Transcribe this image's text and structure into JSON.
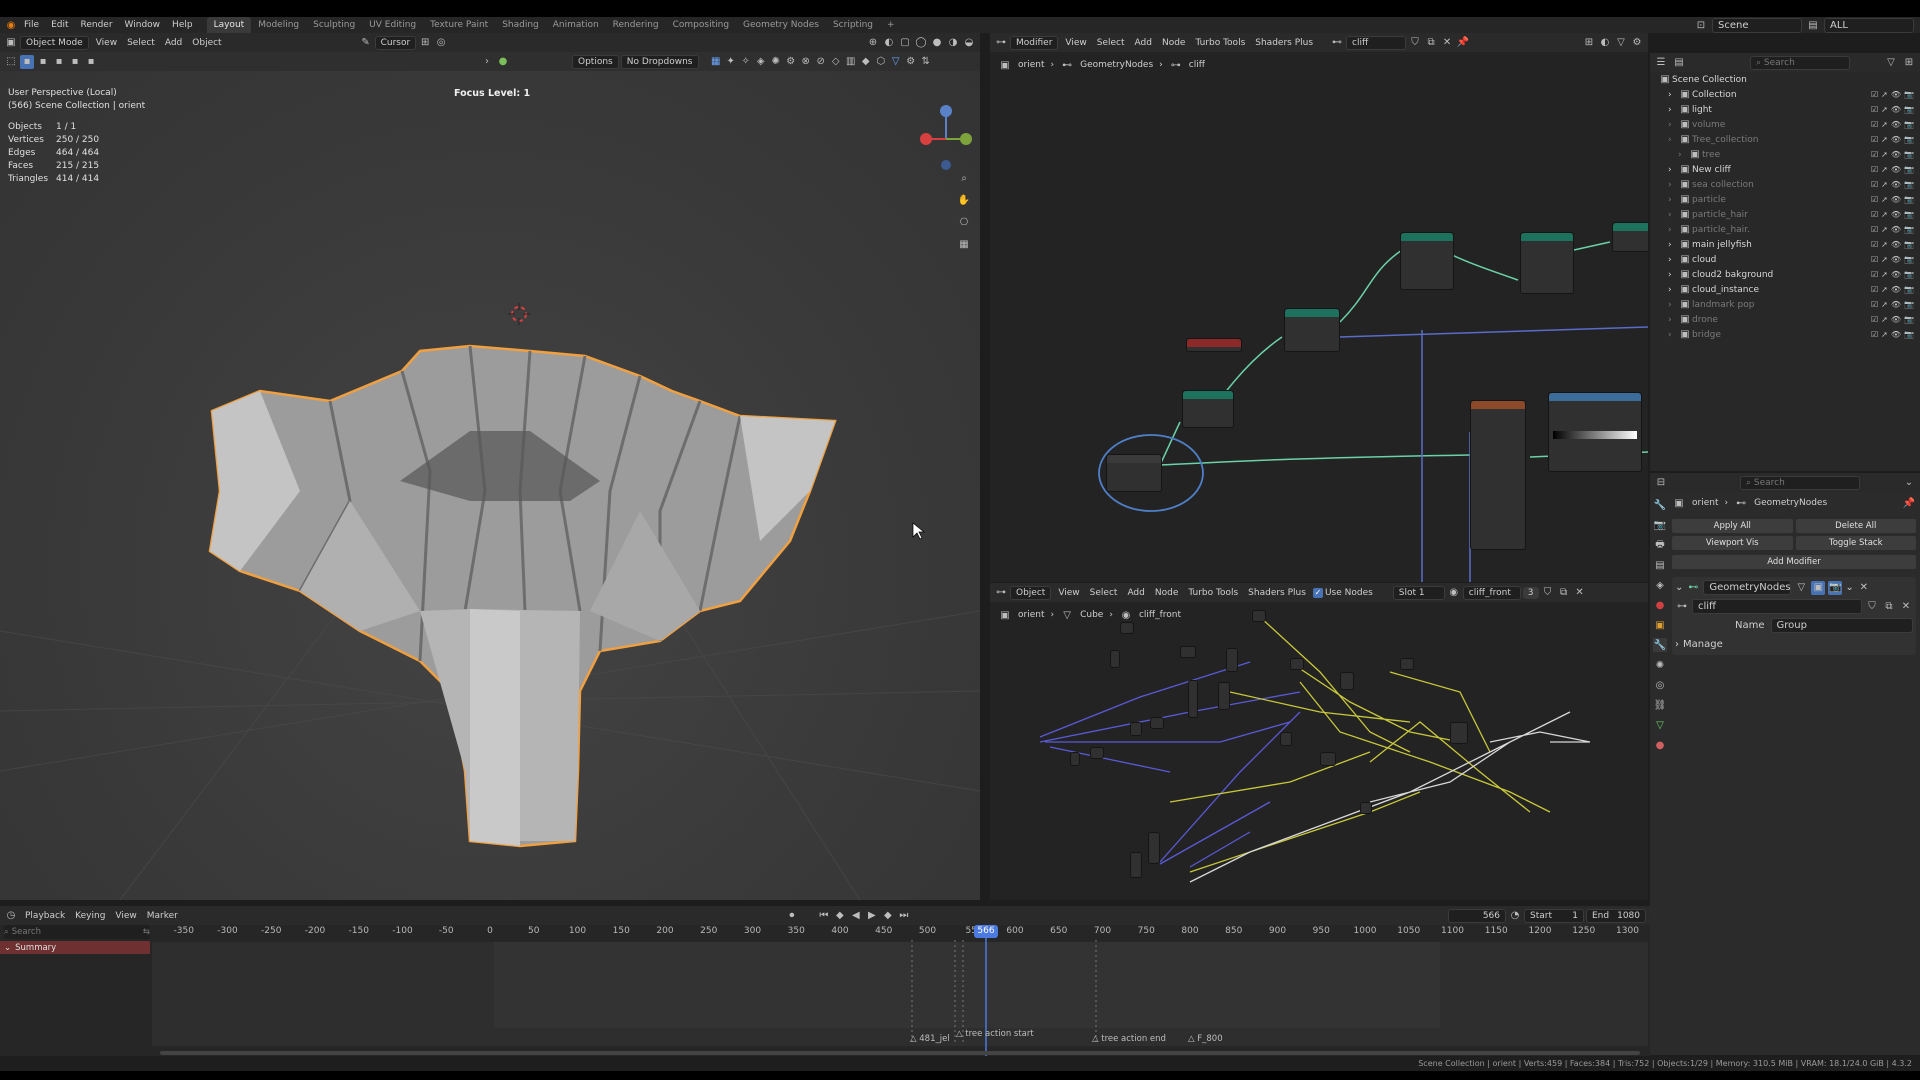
{
  "topbar": {
    "menus": [
      "File",
      "Edit",
      "Render",
      "Window",
      "Help"
    ],
    "workspaces": [
      "Layout",
      "Modeling",
      "Sculpting",
      "UV Editing",
      "Texture Paint",
      "Shading",
      "Animation",
      "Rendering",
      "Compositing",
      "Geometry Nodes",
      "Scripting"
    ],
    "active_workspace": "Layout",
    "scene_label": "Scene",
    "viewlayer_label": "ALL",
    "add_tab": "+"
  },
  "viewport": {
    "header": {
      "mode": "Object Mode",
      "menus": [
        "View",
        "Select",
        "Add",
        "Object"
      ],
      "transform": "Cursor",
      "options": "Options",
      "dropdowns": "No Dropdowns"
    },
    "overlay_text": {
      "perspective": "User Perspective (Local)",
      "collection": "(566) Scene Collection | orient",
      "focus": "Focus Level: 1"
    },
    "stats": [
      {
        "label": "Objects",
        "value": "1 / 1"
      },
      {
        "label": "Vertices",
        "value": "250 / 250"
      },
      {
        "label": "Edges",
        "value": "464 / 464"
      },
      {
        "label": "Faces",
        "value": "215 / 215"
      },
      {
        "label": "Triangles",
        "value": "414 / 414"
      }
    ]
  },
  "node_editor_top": {
    "header": {
      "type": "Modifier",
      "menus": [
        "View",
        "Select",
        "Add",
        "Node",
        "Turbo Tools",
        "Shaders Plus"
      ],
      "tree": "cliff"
    },
    "breadcrumb": [
      "orient",
      "GeometryNodes",
      "cliff"
    ]
  },
  "node_editor_bottom": {
    "header": {
      "type": "Object",
      "menus": [
        "View",
        "Select",
        "Add",
        "Node",
        "Turbo Tools",
        "Shaders Plus"
      ],
      "use_nodes": "Use Nodes",
      "slot": "Slot 1",
      "material": "cliff_front",
      "users": "3"
    },
    "breadcrumb": [
      "orient",
      "Cube",
      "cliff_front"
    ]
  },
  "outliner": {
    "search_placeholder": "Search",
    "root": "Scene Collection",
    "items": [
      {
        "name": "Collection",
        "dim": false
      },
      {
        "name": "light",
        "dim": false
      },
      {
        "name": "volume",
        "dim": true
      },
      {
        "name": "Tree_collection",
        "dim": true
      },
      {
        "name": "tree",
        "dim": true
      },
      {
        "name": "New cliff",
        "dim": false
      },
      {
        "name": "sea collection",
        "dim": true
      },
      {
        "name": "particle",
        "dim": true
      },
      {
        "name": "particle_hair",
        "dim": true
      },
      {
        "name": "particle_hair.",
        "dim": true
      },
      {
        "name": "main jellyfish",
        "dim": false
      },
      {
        "name": "cloud",
        "dim": false
      },
      {
        "name": "cloud2 bakground",
        "dim": false
      },
      {
        "name": "cloud_instance",
        "dim": false
      },
      {
        "name": "landmark pop",
        "dim": true
      },
      {
        "name": "drone",
        "dim": true
      },
      {
        "name": "bridge",
        "dim": true
      }
    ]
  },
  "properties": {
    "search_placeholder": "Search",
    "breadcrumb": [
      "orient",
      "GeometryNodes"
    ],
    "apply_all": "Apply All",
    "delete_all": "Delete All",
    "viewport_vis": "Viewport Vis",
    "toggle_stack": "Toggle Stack",
    "add_modifier": "Add Modifier",
    "modifier_name": "GeometryNodes",
    "node_group": "cliff",
    "name_label": "Name",
    "name_value": "Group",
    "manage": "Manage"
  },
  "timeline": {
    "menus": [
      "Playback",
      "Keying",
      "View",
      "Marker"
    ],
    "current_frame": "566",
    "start_label": "Start",
    "start_value": "1",
    "end_label": "End",
    "end_value": "1080",
    "search_placeholder": "Search",
    "summary": "Summary",
    "ticks": [
      "-350",
      "-300",
      "-250",
      "-200",
      "-150",
      "-100",
      "-50",
      "0",
      "50",
      "100",
      "150",
      "200",
      "250",
      "300",
      "350",
      "400",
      "450",
      "500",
      "55",
      "600",
      "650",
      "700",
      "750",
      "800",
      "850",
      "900",
      "950",
      "1000",
      "1050",
      "1100",
      "1150",
      "1200",
      "1250",
      "1300"
    ],
    "playhead_label": "566",
    "markers": [
      "481_jel",
      "tree action start",
      "tree action end",
      "F_800"
    ]
  },
  "statusbar": "Scene Collection | orient | Verts:459 | Faces:384 | Tris:752 | Objects:1/29 | Memory: 310.5 MiB | VRAM: 18.1/24.0 GiB | 4.3.2",
  "colors": {
    "accent": "#4772b3",
    "selected_outline": "#f0a040",
    "playhead": "#4b7ae0"
  }
}
